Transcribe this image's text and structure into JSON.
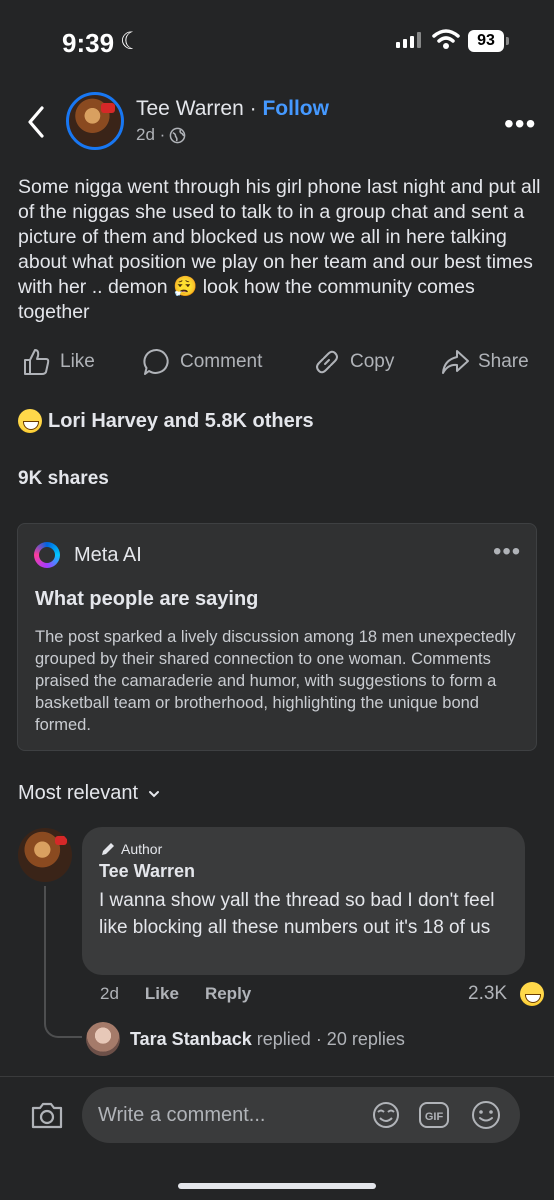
{
  "status_bar": {
    "time": "9:39",
    "battery": "93"
  },
  "post": {
    "author": "Tee Warren",
    "separator": "·",
    "follow_label": "Follow",
    "age": "2d ·",
    "text": "Some nigga went through his girl phone last night and put all of the niggas she used to talk to in a group chat and sent a picture of them and blocked us now we all in here talking about what position we play on her team and our best times with her .. demon 😮‍💨 look how the community comes together"
  },
  "actions": {
    "like": "Like",
    "comment": "Comment",
    "copy": "Copy",
    "share": "Share"
  },
  "reactions_text": "Lori Harvey and 5.8K others",
  "shares_text": "9K shares",
  "meta_ai": {
    "brand": "Meta AI",
    "title": "What people are saying",
    "body": "The post sparked a lively discussion among 18 men unexpectedly grouped by their shared connection to one woman. Comments praised the camaraderie and humor, with suggestions to form a basketball team or brotherhood, highlighting the unique bond formed."
  },
  "sort_label": "Most relevant",
  "comment": {
    "badge": "Author",
    "name": "Tee Warren",
    "text": "I wanna show yall the thread so bad I don't feel like blocking all these numbers out it's 18 of us",
    "age": "2d",
    "like": "Like",
    "reply": "Reply",
    "reaction_count": "2.3K",
    "reply_preview": {
      "name": "Tara Stanback",
      "action": "replied",
      "count": "· 20 replies"
    }
  },
  "composer": {
    "placeholder": "Write a comment..."
  }
}
